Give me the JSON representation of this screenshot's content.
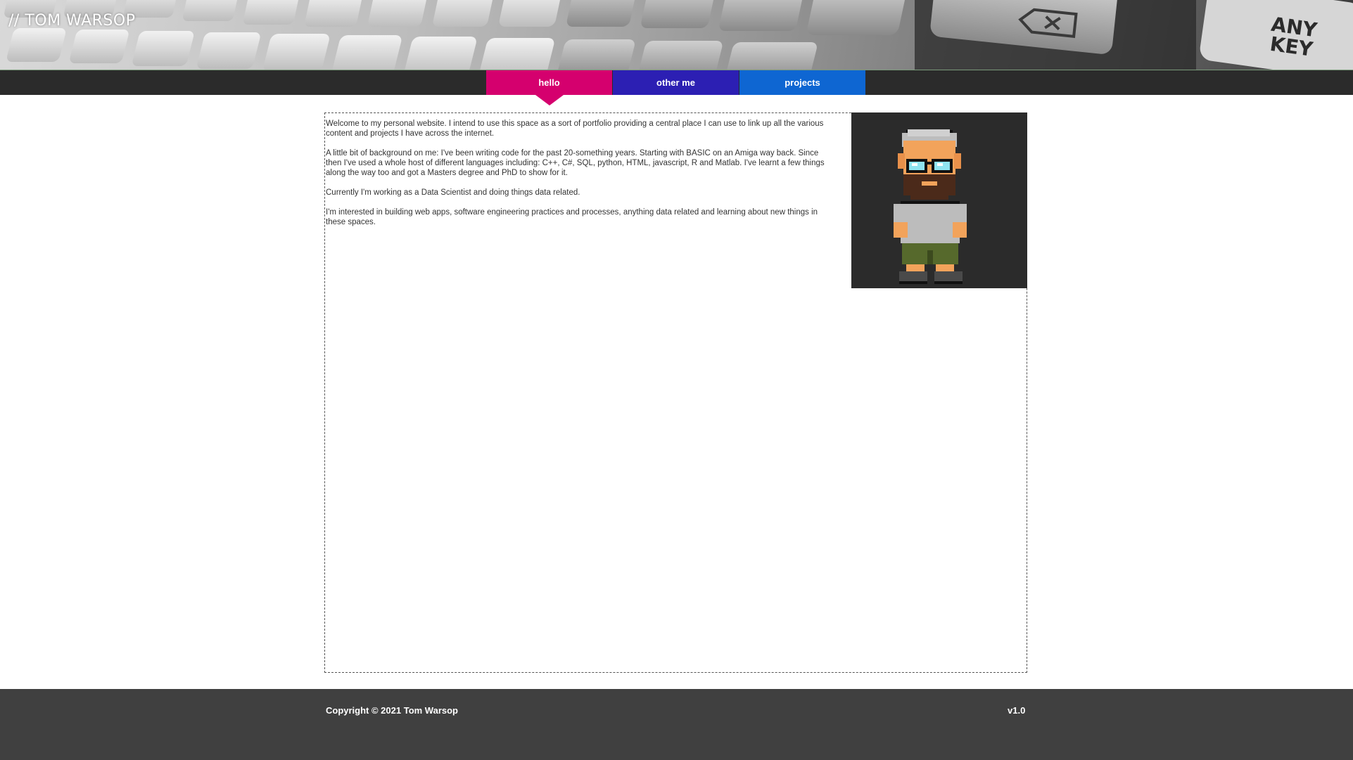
{
  "site": {
    "title": "// TOM WARSOP"
  },
  "banner": {
    "key_label_line1": "ANY",
    "key_label_line2": "KEY"
  },
  "nav": {
    "tabs": [
      {
        "label": "hello",
        "color": "#d5006e",
        "active": true
      },
      {
        "label": "other me",
        "color": "#2c1fb3",
        "active": false
      },
      {
        "label": "projects",
        "color": "#0e66d2",
        "active": false
      }
    ]
  },
  "main": {
    "paragraphs": [
      "Welcome to my personal website. I intend to use this space as a sort of portfolio providing a central place I can use to link up all the various content and projects I have across the internet.",
      "A little bit of background on me: I've been writing code for the past 20-something years. Starting with BASIC on an Amiga way back. Since then I've used a whole host of different languages including: C++, C#, SQL, python, HTML, javascript, R and Matlab. I've learnt a few things along the way too and got a Masters degree and PhD to show for it.",
      "Currently I'm working as a Data Scientist and doing things data related.",
      "I'm interested in building web apps, software engineering practices and processes, anything data related and learning about new things in these spaces."
    ],
    "avatar_icon": "pixel-art-avatar"
  },
  "footer": {
    "copyright": "Copyright © 2021 Tom Warsop",
    "version": "v1.0"
  }
}
